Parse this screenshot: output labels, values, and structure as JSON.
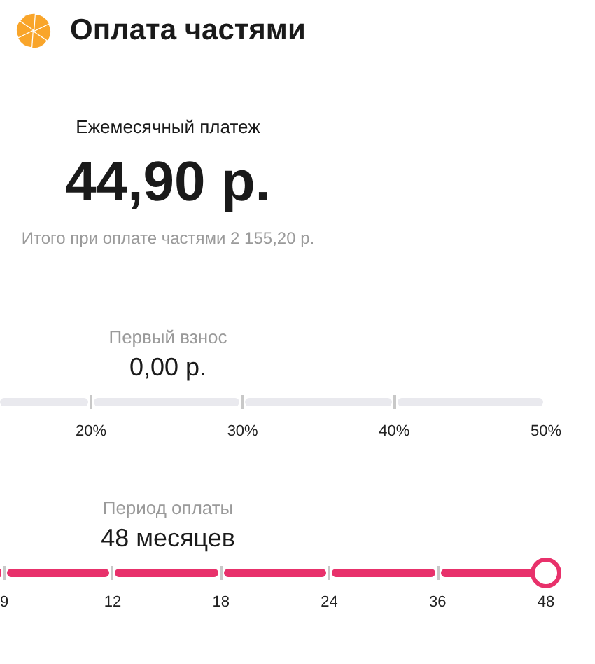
{
  "header": {
    "title": "Оплата частями"
  },
  "summary": {
    "label": "Ежемесячный платеж",
    "amount": "44,90 р.",
    "total": "Итого при оплате частями 2 155,20 р."
  },
  "sliders": [
    {
      "label": "Первый взнос",
      "value": "0,00 р.",
      "ticks": [
        "20%",
        "30%",
        "40%",
        "50%"
      ]
    },
    {
      "label": "Период оплаты",
      "value": "48 месяцев",
      "level": 1,
      "ticks": [
        "9",
        "12",
        "18",
        "24",
        "36",
        "48"
      ]
    }
  ]
}
